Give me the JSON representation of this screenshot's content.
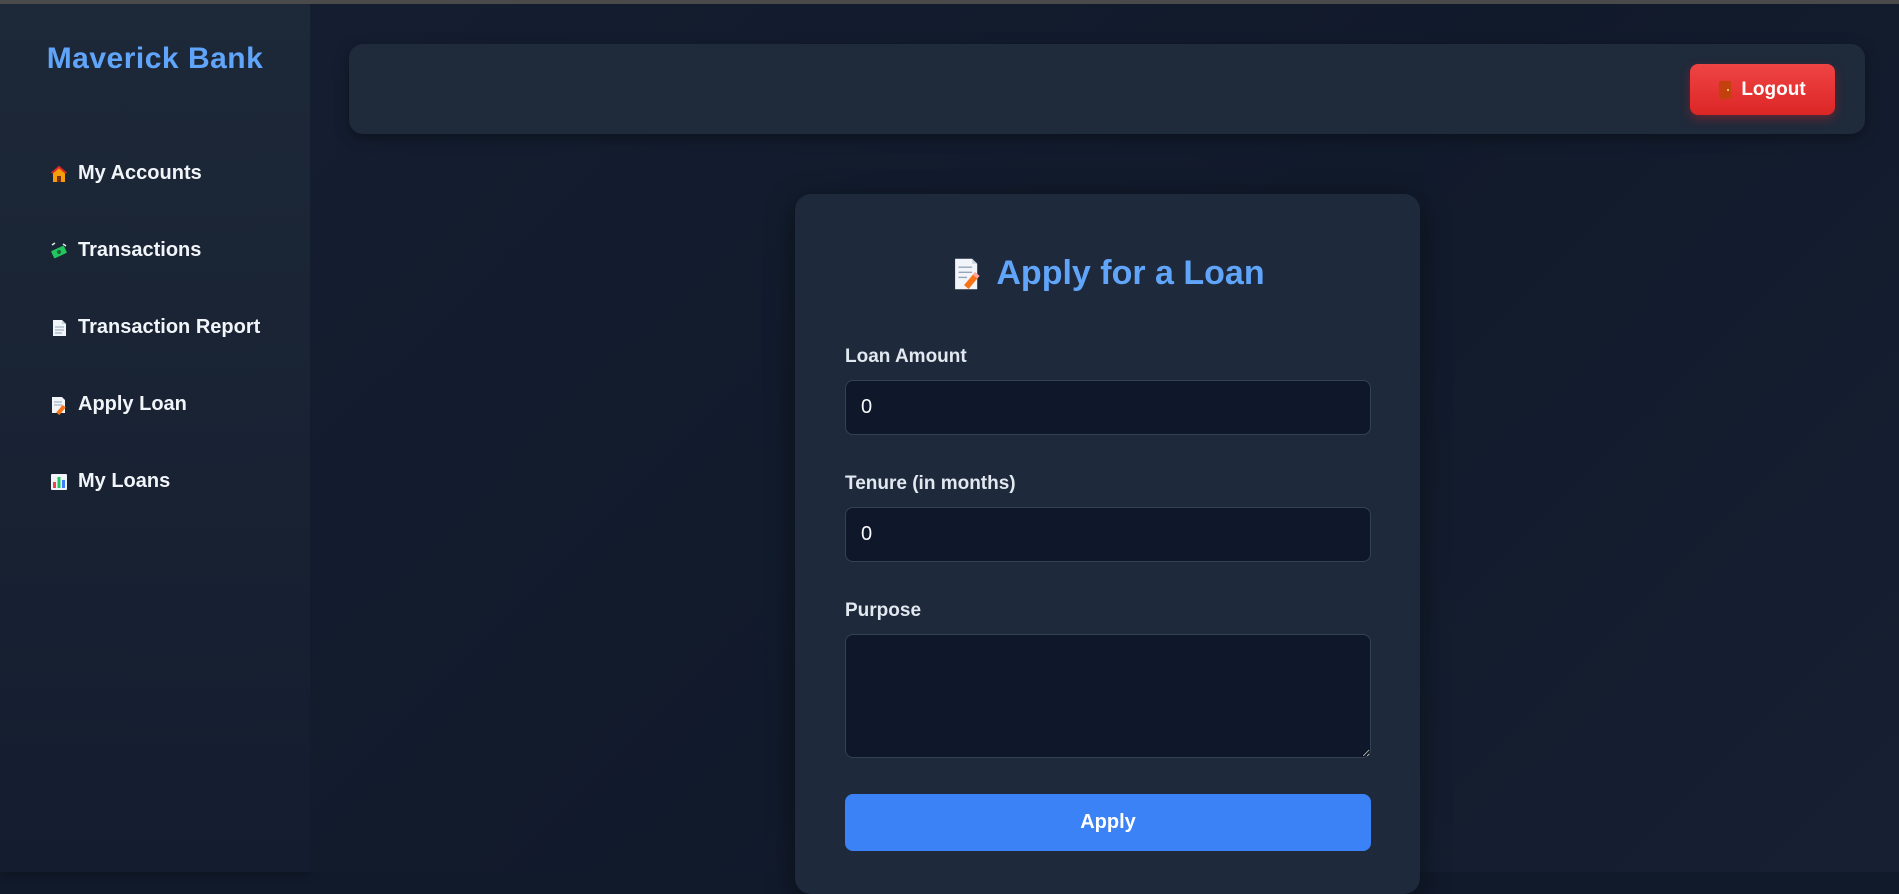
{
  "brand": {
    "name": "Maverick Bank"
  },
  "sidebar": {
    "items": [
      {
        "label": "My Accounts",
        "icon": "house-icon"
      },
      {
        "label": "Transactions",
        "icon": "money-icon"
      },
      {
        "label": "Transaction Report",
        "icon": "page-icon"
      },
      {
        "label": "Apply Loan",
        "icon": "memo-icon"
      },
      {
        "label": "My Loans",
        "icon": "bar-chart-icon"
      }
    ]
  },
  "header": {
    "logout_label": "Logout",
    "logout_icon": "door-icon"
  },
  "form": {
    "title": "Apply for a Loan",
    "title_icon": "memo-icon",
    "loan_amount_label": "Loan Amount",
    "loan_amount_value": "0",
    "tenure_label": "Tenure (in months)",
    "tenure_value": "0",
    "purpose_label": "Purpose",
    "purpose_value": "",
    "submit_label": "Apply"
  },
  "colors": {
    "accent": "#60a5fa",
    "primary_button": "#3b82f6",
    "danger_button": "#ef4444",
    "background": "#111a2b",
    "card": "#1e293b"
  }
}
